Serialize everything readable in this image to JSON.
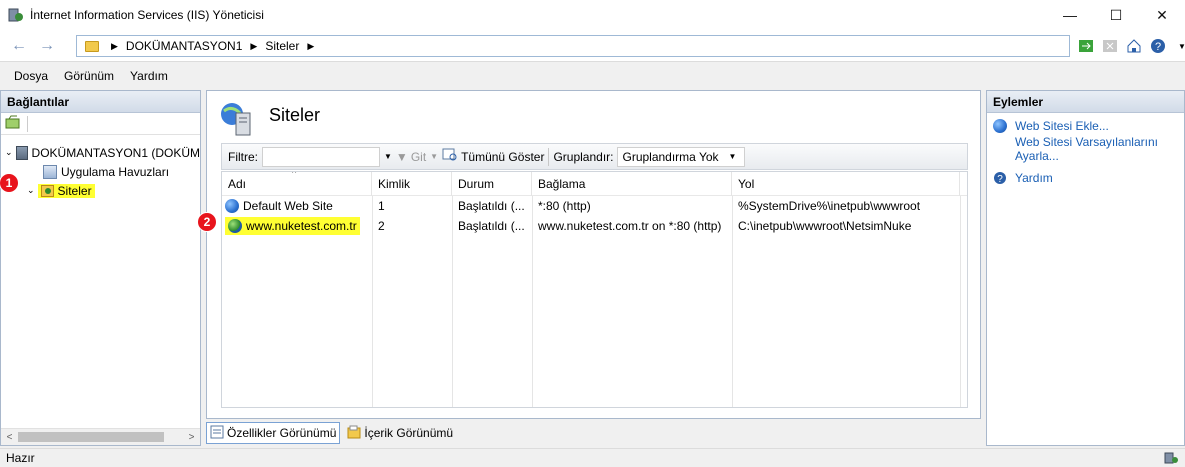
{
  "window": {
    "title": "İnternet Information Services (IIS) Yöneticisi",
    "minimize": "—",
    "maximize": "☐",
    "close": "✕"
  },
  "address": {
    "back": "←",
    "forward": "→",
    "crumbs": [
      "DOKÜMANTASYON1",
      "Siteler"
    ],
    "sep": "▶"
  },
  "menu": [
    "Dosya",
    "Görünüm",
    "Yardım"
  ],
  "left_panel": {
    "header": "Bağlantılar",
    "tree": {
      "server": "DOKÜMANTASYON1 (DOKÜM",
      "pools": "Uygulama Havuzları",
      "sites": "Siteler"
    },
    "marker": "1"
  },
  "main": {
    "title": "Siteler",
    "filter_label": "Filtre:",
    "go_label": "Git",
    "show_all": "Tümünü Göster",
    "group_label": "Gruplandır:",
    "group_value": "Gruplandırma Yok",
    "columns": [
      "Adı",
      "Kimlik",
      "Durum",
      "Bağlama",
      "Yol"
    ],
    "rows": [
      [
        "Default Web Site",
        "1",
        "Başlatıldı (...",
        "*:80 (http)",
        "%SystemDrive%\\inetpub\\wwwroot"
      ],
      [
        "www.nuketest.com.tr",
        "2",
        "Başlatıldı (...",
        "www.nuketest.com.tr on *:80 (http)",
        "C:\\inetpub\\wwwroot\\NetsimNuke"
      ]
    ],
    "marker": "2"
  },
  "bottom_tabs": [
    "Özellikler Görünümü",
    "İçerik Görünümü"
  ],
  "right_panel": {
    "header": "Eylemler",
    "actions": [
      "Web Sitesi Ekle...",
      "Web Sitesi Varsayılanlarını Ayarla...",
      "Yardım"
    ]
  },
  "status": "Hazır",
  "colors": {
    "highlight": "#ffff33",
    "marker": "#e8141c",
    "link": "#1a5fb4"
  }
}
